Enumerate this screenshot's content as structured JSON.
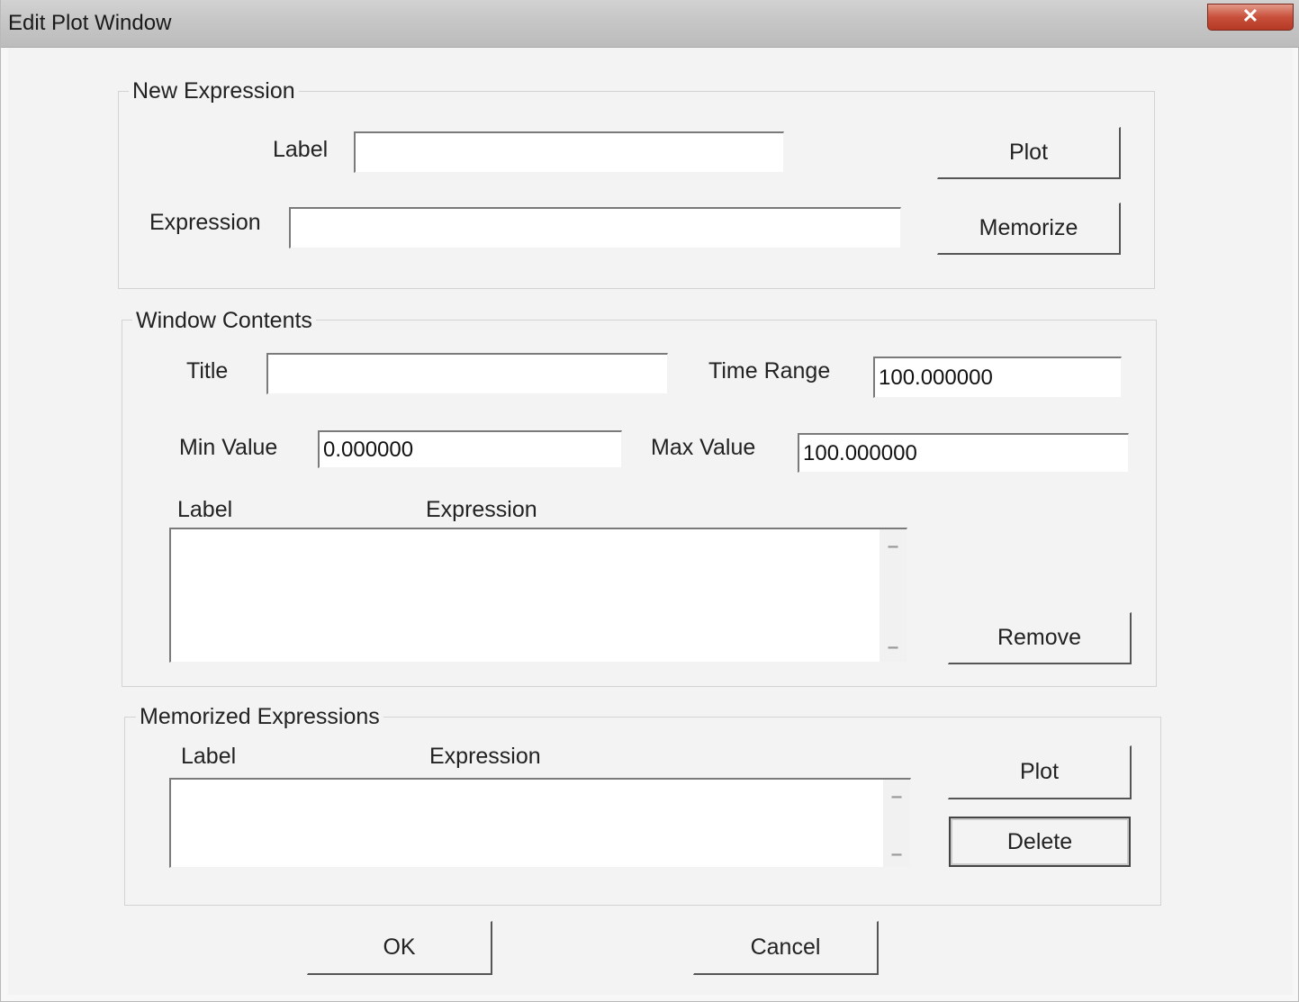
{
  "window": {
    "title": "Edit Plot Window",
    "close_glyph": "✕"
  },
  "new_expression": {
    "group_title": "New Expression",
    "label_caption": "Label",
    "label_value": "",
    "expression_caption": "Expression",
    "expression_value": "",
    "plot_button": "Plot",
    "memorize_button": "Memorize"
  },
  "window_contents": {
    "group_title": "Window Contents",
    "title_caption": "Title",
    "title_value": "",
    "time_range_caption": "Time Range",
    "time_range_value": "100.000000",
    "min_value_caption": "Min Value",
    "min_value": "0.000000",
    "max_value_caption": "Max Value",
    "max_value": "100.000000",
    "list_columns": [
      "Label",
      "Expression"
    ],
    "remove_button": "Remove"
  },
  "memorized_expressions": {
    "group_title": "Memorized Expressions",
    "list_columns": [
      "Label",
      "Expression"
    ],
    "plot_button": "Plot",
    "delete_button": "Delete"
  },
  "dialog_buttons": {
    "ok": "OK",
    "cancel": "Cancel"
  },
  "icons": {
    "close": "close-icon",
    "scroll_up": "scroll-up-arrow-icon",
    "scroll_down": "scroll-down-arrow-icon"
  }
}
